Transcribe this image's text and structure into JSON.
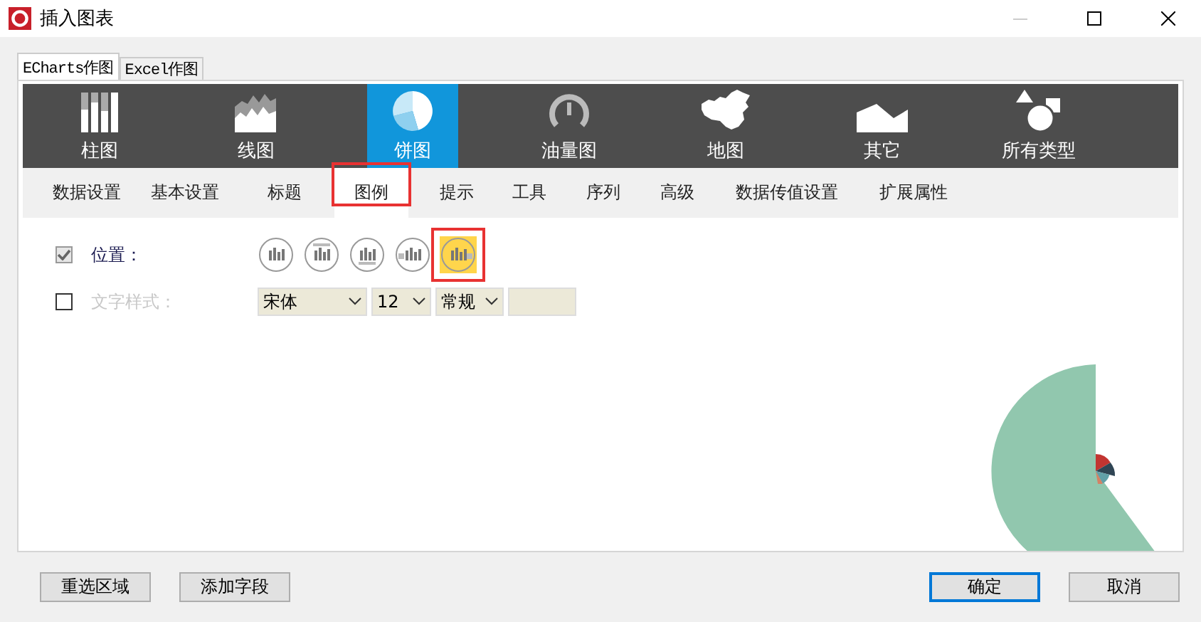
{
  "window": {
    "title": "插入图表"
  },
  "source_tabs": [
    {
      "label": "ECharts作图",
      "selected": true
    },
    {
      "label": "Excel作图",
      "selected": false
    }
  ],
  "chart_types": [
    {
      "kind": "bar",
      "label": "柱图",
      "selected": false
    },
    {
      "kind": "line",
      "label": "线图",
      "selected": false
    },
    {
      "kind": "pie",
      "label": "饼图",
      "selected": true
    },
    {
      "kind": "gauge",
      "label": "油量图",
      "selected": false
    },
    {
      "kind": "map",
      "label": "地图",
      "selected": false
    },
    {
      "kind": "other",
      "label": "其它",
      "selected": false
    },
    {
      "kind": "all",
      "label": "所有类型",
      "selected": false
    }
  ],
  "settings_tabs": [
    {
      "label": "数据设置",
      "selected": false,
      "highlighted": false
    },
    {
      "label": "基本设置",
      "selected": false,
      "highlighted": false
    },
    {
      "label": "标题",
      "selected": false,
      "highlighted": false
    },
    {
      "label": "图例",
      "selected": true,
      "highlighted": true
    },
    {
      "label": "提示",
      "selected": false,
      "highlighted": false
    },
    {
      "label": "工具",
      "selected": false,
      "highlighted": false
    },
    {
      "label": "序列",
      "selected": false,
      "highlighted": false
    },
    {
      "label": "高级",
      "selected": false,
      "highlighted": false
    },
    {
      "label": "数据传值设置",
      "selected": false,
      "highlighted": false
    },
    {
      "label": "扩展属性",
      "selected": false,
      "highlighted": false
    }
  ],
  "position": {
    "label": "位置：",
    "checked": true,
    "options": [
      {
        "kind": "none",
        "selected": false,
        "highlighted": false
      },
      {
        "kind": "top",
        "selected": false,
        "highlighted": false
      },
      {
        "kind": "bottom",
        "selected": false,
        "highlighted": false
      },
      {
        "kind": "left",
        "selected": false,
        "highlighted": false
      },
      {
        "kind": "right",
        "selected": true,
        "highlighted": true
      }
    ]
  },
  "text_style": {
    "label": "文字样式：",
    "checked": false,
    "font": "宋体",
    "size": "12",
    "weight": "常规"
  },
  "buttons_left": [
    {
      "label": "重选区域",
      "default": false
    },
    {
      "label": "添加字段",
      "default": false
    }
  ],
  "buttons_right": [
    {
      "label": "确定",
      "default": true
    },
    {
      "label": "取消",
      "default": false
    }
  ]
}
